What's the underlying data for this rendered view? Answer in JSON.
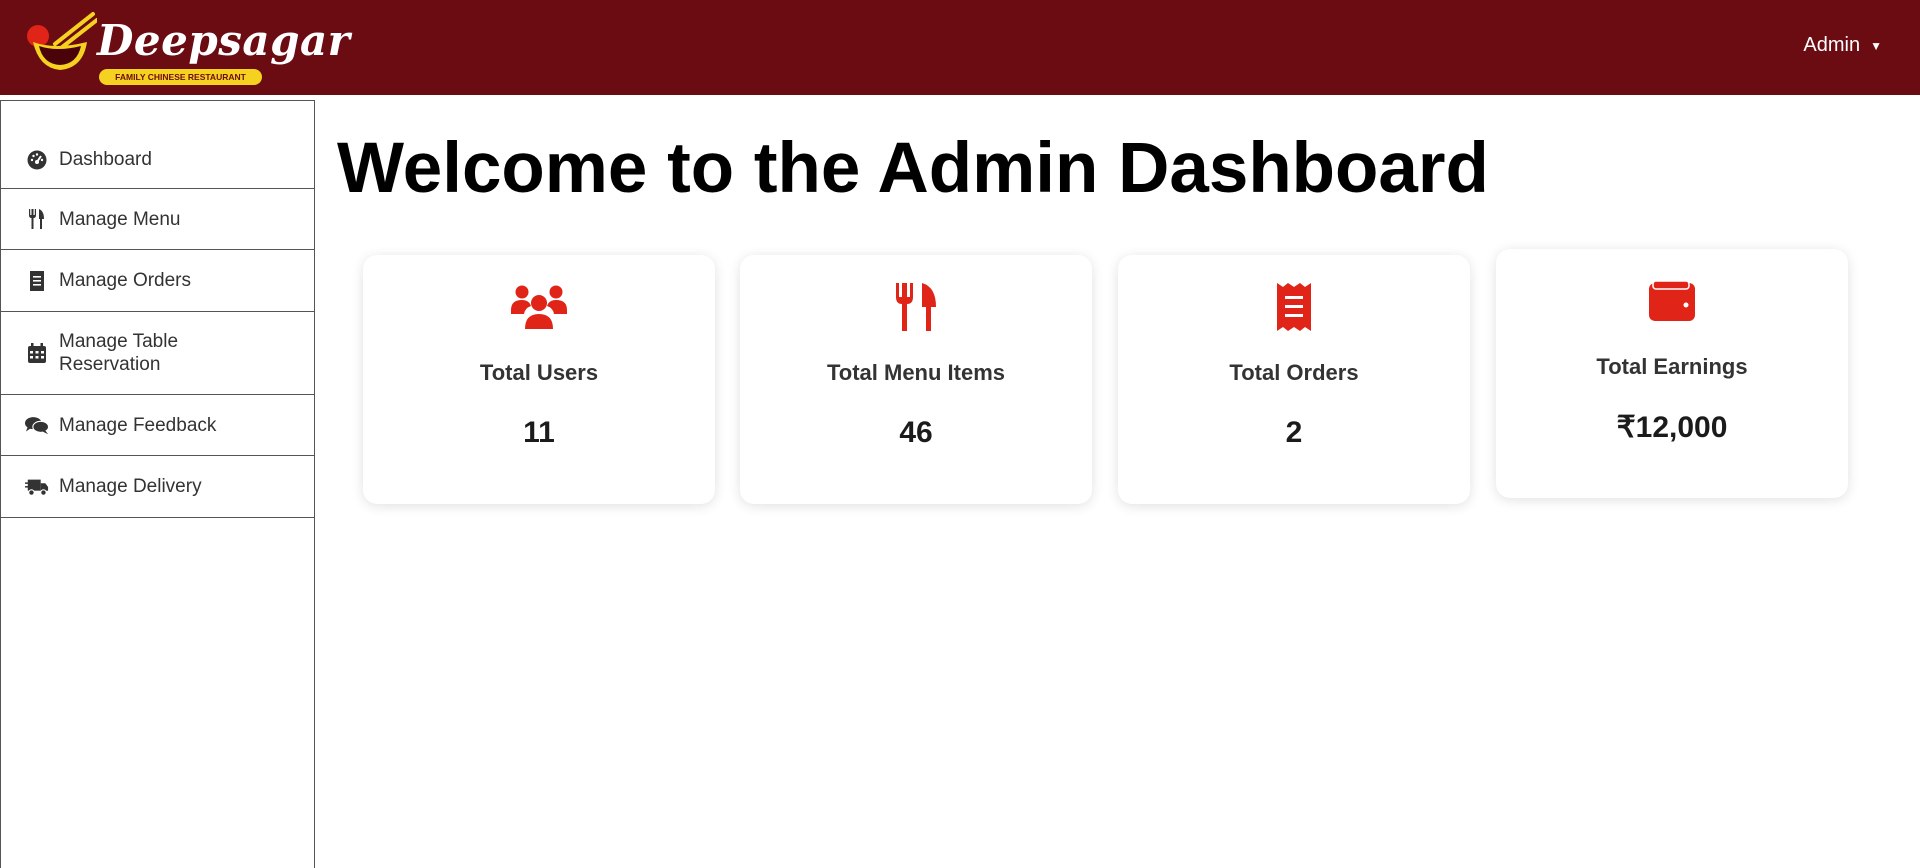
{
  "header": {
    "brand": "Deepsagar",
    "tagline": "FAMILY CHINESE RESTAURANT",
    "user_menu_label": "Admin",
    "background_color": "#6b0b12"
  },
  "sidebar": {
    "items": [
      {
        "label": "Dashboard",
        "icon": "gauge-icon"
      },
      {
        "label": "Manage Menu",
        "icon": "utensils-icon"
      },
      {
        "label": "Manage Orders",
        "icon": "receipt-icon"
      },
      {
        "label": "Manage Table Reservation",
        "icon": "calendar-icon"
      },
      {
        "label": "Manage Feedback",
        "icon": "comments-icon"
      },
      {
        "label": "Manage Delivery",
        "icon": "truck-icon"
      }
    ]
  },
  "main": {
    "title": "Welcome to the Admin Dashboard",
    "cards": [
      {
        "label": "Total Users",
        "value": "11",
        "icon": "users-icon"
      },
      {
        "label": "Total Menu Items",
        "value": "46",
        "icon": "utensils-icon"
      },
      {
        "label": "Total Orders",
        "value": "2",
        "icon": "receipt-icon"
      },
      {
        "label": "Total Earnings",
        "value": "₹12,000",
        "icon": "wallet-icon"
      }
    ],
    "accent_color": "#e02418"
  }
}
